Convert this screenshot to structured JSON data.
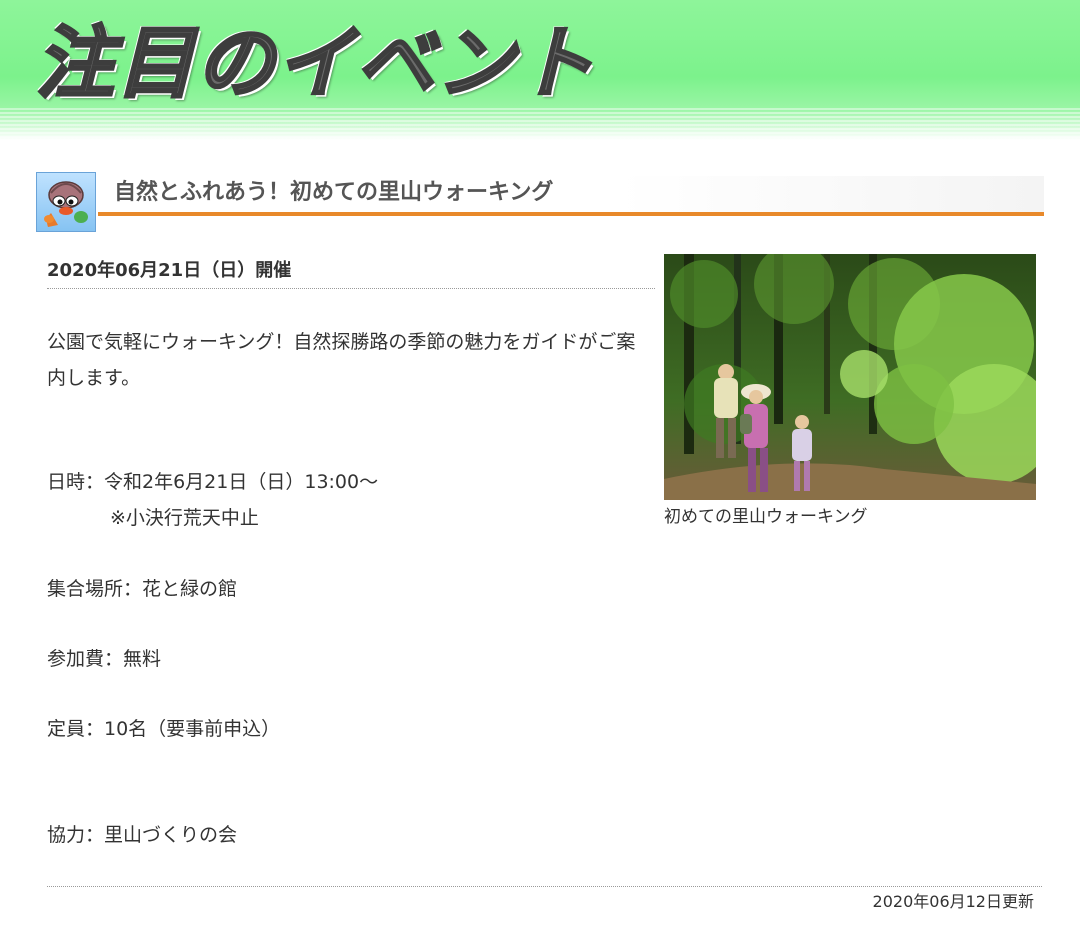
{
  "banner": {
    "title": "注目のイベント"
  },
  "event": {
    "title": "自然とふれあう！初めての里山ウォーキング",
    "date_heading": "2020年06月21日（日）開催",
    "description": "公園で気軽にウォーキング！自然探勝路の季節の魅力をガイドがご案内します。",
    "datetime_line": "日時：令和2年6月21日（日）13:00〜",
    "weather_note": "※小決行荒天中止",
    "venue_line": "集合場所：花と緑の館",
    "fee_line": "参加費：無料",
    "capacity_line": "定員：10名（要事前申込）",
    "cooperation_line": "協力：里山づくりの会",
    "photo_caption": "初めての里山ウォーキング"
  },
  "footer": {
    "updated": "2020年06月12日更新"
  },
  "colors": {
    "banner_green": "#7cf28c",
    "heading_underline": "#e8892a",
    "text": "#333333"
  },
  "icons": {
    "mascot": "mascot-icon"
  }
}
